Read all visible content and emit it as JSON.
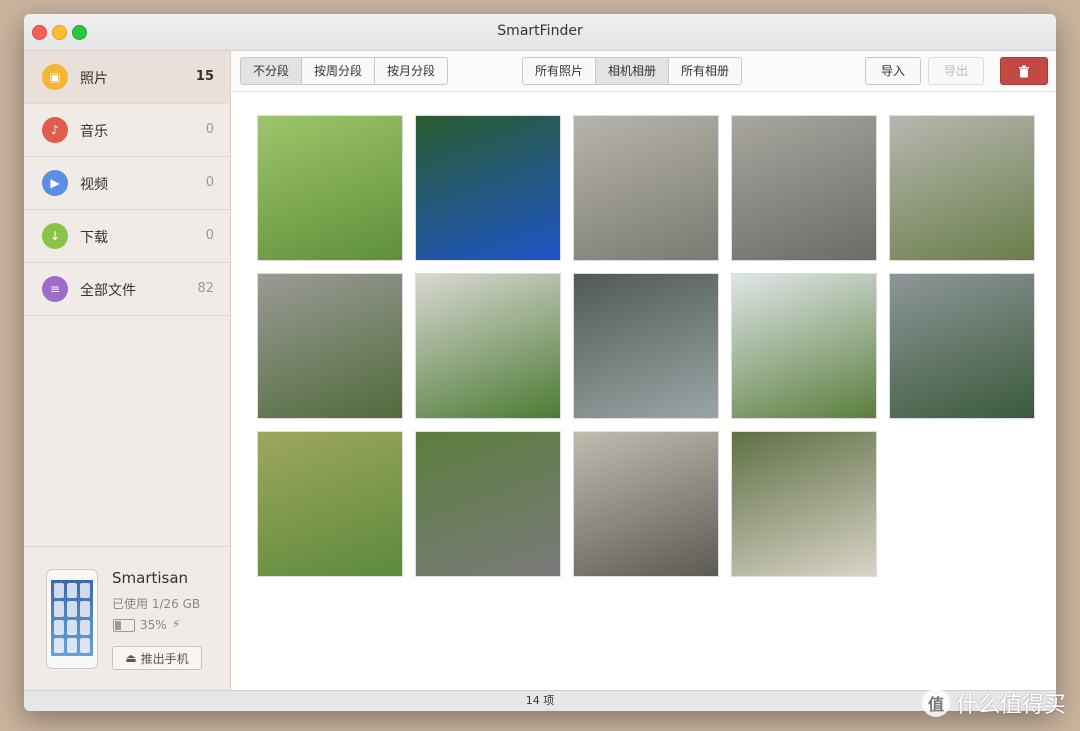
{
  "window": {
    "title": "SmartFinder"
  },
  "sidebar": {
    "items": [
      {
        "label": "照片",
        "count": "15",
        "icon": "photo-icon",
        "color": "#f7b432",
        "active": true
      },
      {
        "label": "音乐",
        "count": "0",
        "icon": "music-icon",
        "color": "#e15b4f"
      },
      {
        "label": "视频",
        "count": "0",
        "icon": "video-icon",
        "color": "#5b8fe6"
      },
      {
        "label": "下载",
        "count": "0",
        "icon": "download-icon",
        "color": "#8bc34a"
      },
      {
        "label": "全部文件",
        "count": "82",
        "icon": "files-icon",
        "color": "#9d6bc9"
      }
    ]
  },
  "device": {
    "name": "Smartisan",
    "usage": "已使用 1/26 GB",
    "battery_percent": "35%",
    "battery_level": 0.35,
    "eject_label": "推出手机"
  },
  "toolbar": {
    "group_tabs": [
      "不分段",
      "按周分段",
      "按月分段"
    ],
    "group_active": 0,
    "album_tabs": [
      "所有照片",
      "相机相册",
      "所有相册"
    ],
    "album_active": 1,
    "import_label": "导入",
    "export_label": "导出"
  },
  "photos": [
    {
      "label": "plants",
      "colors": [
        "#5f8f3a",
        "#9ec56b"
      ]
    },
    {
      "label": "sign",
      "colors": [
        "#1e55c8",
        "#2a5c2f"
      ]
    },
    {
      "label": "bench",
      "colors": [
        "#7b7a72",
        "#b6b4ab"
      ]
    },
    {
      "label": "bench-2",
      "colors": [
        "#6c6b66",
        "#a8a69f"
      ]
    },
    {
      "label": "sculpture",
      "colors": [
        "#6a7d4a",
        "#b7b7b0"
      ]
    },
    {
      "label": "sculpture-2",
      "colors": [
        "#516b3c",
        "#9a9a95"
      ]
    },
    {
      "label": "leaves-path",
      "colors": [
        "#4c7b35",
        "#d9d8d2"
      ]
    },
    {
      "label": "lake",
      "colors": [
        "#9aa5a5",
        "#4f5a58"
      ]
    },
    {
      "label": "tree",
      "colors": [
        "#5b7f3e",
        "#dfe6e8"
      ]
    },
    {
      "label": "reeds-sculpture",
      "colors": [
        "#3b5a3c",
        "#8d9698"
      ]
    },
    {
      "label": "grass-leaves",
      "colors": [
        "#5c8a3c",
        "#9ea75e"
      ]
    },
    {
      "label": "road",
      "colors": [
        "#7a7a7a",
        "#5b7e3e"
      ]
    },
    {
      "label": "flower-stone",
      "colors": [
        "#5c5a54",
        "#c0bcb0"
      ]
    },
    {
      "label": "buildings",
      "colors": [
        "#d9d4c7",
        "#5f7045"
      ]
    }
  ],
  "status": {
    "count_label": "14 项"
  },
  "watermark": {
    "logo": "值",
    "text": "什么值得买"
  }
}
